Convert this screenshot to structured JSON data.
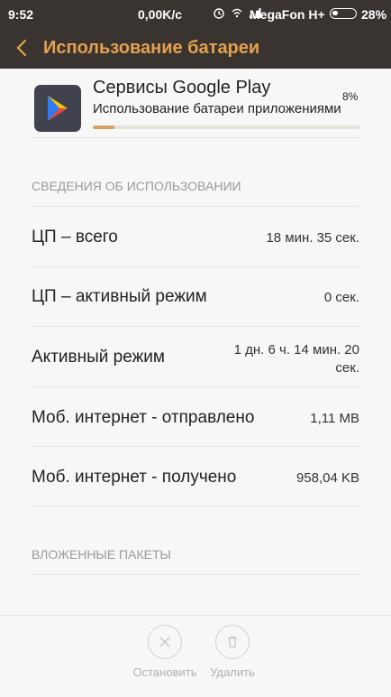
{
  "status": {
    "time": "9:52",
    "speed": "0,00K/c",
    "carrier": "MegaFon H+",
    "battery": "28%"
  },
  "header": {
    "title": "Использование батареи"
  },
  "app": {
    "name": "Сервисы Google Play",
    "description": "Использование батареи приложениями",
    "percent": "8%",
    "usage_fraction": 0.08
  },
  "usage": {
    "section_title": "СВЕДЕНИЯ ОБ ИСПОЛЬЗОВАНИИ",
    "rows": [
      {
        "label": "ЦП – всего",
        "value": "18 мин. 35 сек."
      },
      {
        "label": "ЦП – активный режим",
        "value": "0 сек."
      },
      {
        "label": "Активный режим",
        "value": "1 дн. 6 ч. 14 мин. 20 сек."
      },
      {
        "label": "Моб. интернет - отправлено",
        "value": "1,11 MB"
      },
      {
        "label": "Моб. интернет - получено",
        "value": "958,04 KB"
      }
    ]
  },
  "packages": {
    "section_title": "ВЛОЖЕННЫЕ ПАКЕТЫ"
  },
  "actions": {
    "stop_label": "Остановить",
    "delete_label": "Удалить"
  },
  "colors": {
    "accent": "#e4a14f",
    "header_bg": "#3a3430",
    "progress_fill": "#d6a263"
  }
}
